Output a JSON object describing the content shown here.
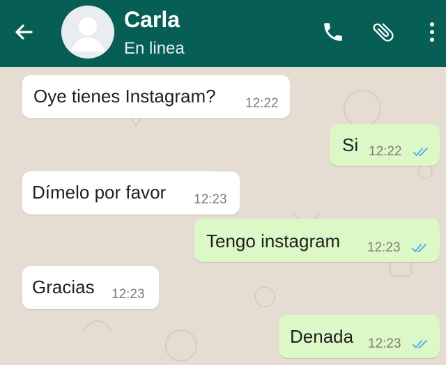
{
  "header": {
    "contact_name": "Carla",
    "status": "En linea",
    "back_icon": "arrow-left-icon",
    "call_icon": "phone-icon",
    "attach_icon": "paperclip-icon",
    "menu_icon": "more-vert-icon",
    "background_color": "#075e54"
  },
  "messages": [
    {
      "direction": "in",
      "text": "Oye tienes Instagram?",
      "time": "12:22"
    },
    {
      "direction": "out",
      "text": "Si",
      "time": "12:22",
      "read": true
    },
    {
      "direction": "in",
      "text": "Dímelo por favor",
      "time": "12:23"
    },
    {
      "direction": "out",
      "text": "Tengo instagram",
      "time": "12:23",
      "read": true
    },
    {
      "direction": "in",
      "text": "Gracias",
      "time": "12:23"
    },
    {
      "direction": "out",
      "text": "Denada",
      "time": "12:23",
      "read": true
    }
  ],
  "colors": {
    "incoming_bubble": "#ffffff",
    "outgoing_bubble": "#dcf8c6",
    "read_ticks": "#4fb6ec"
  }
}
